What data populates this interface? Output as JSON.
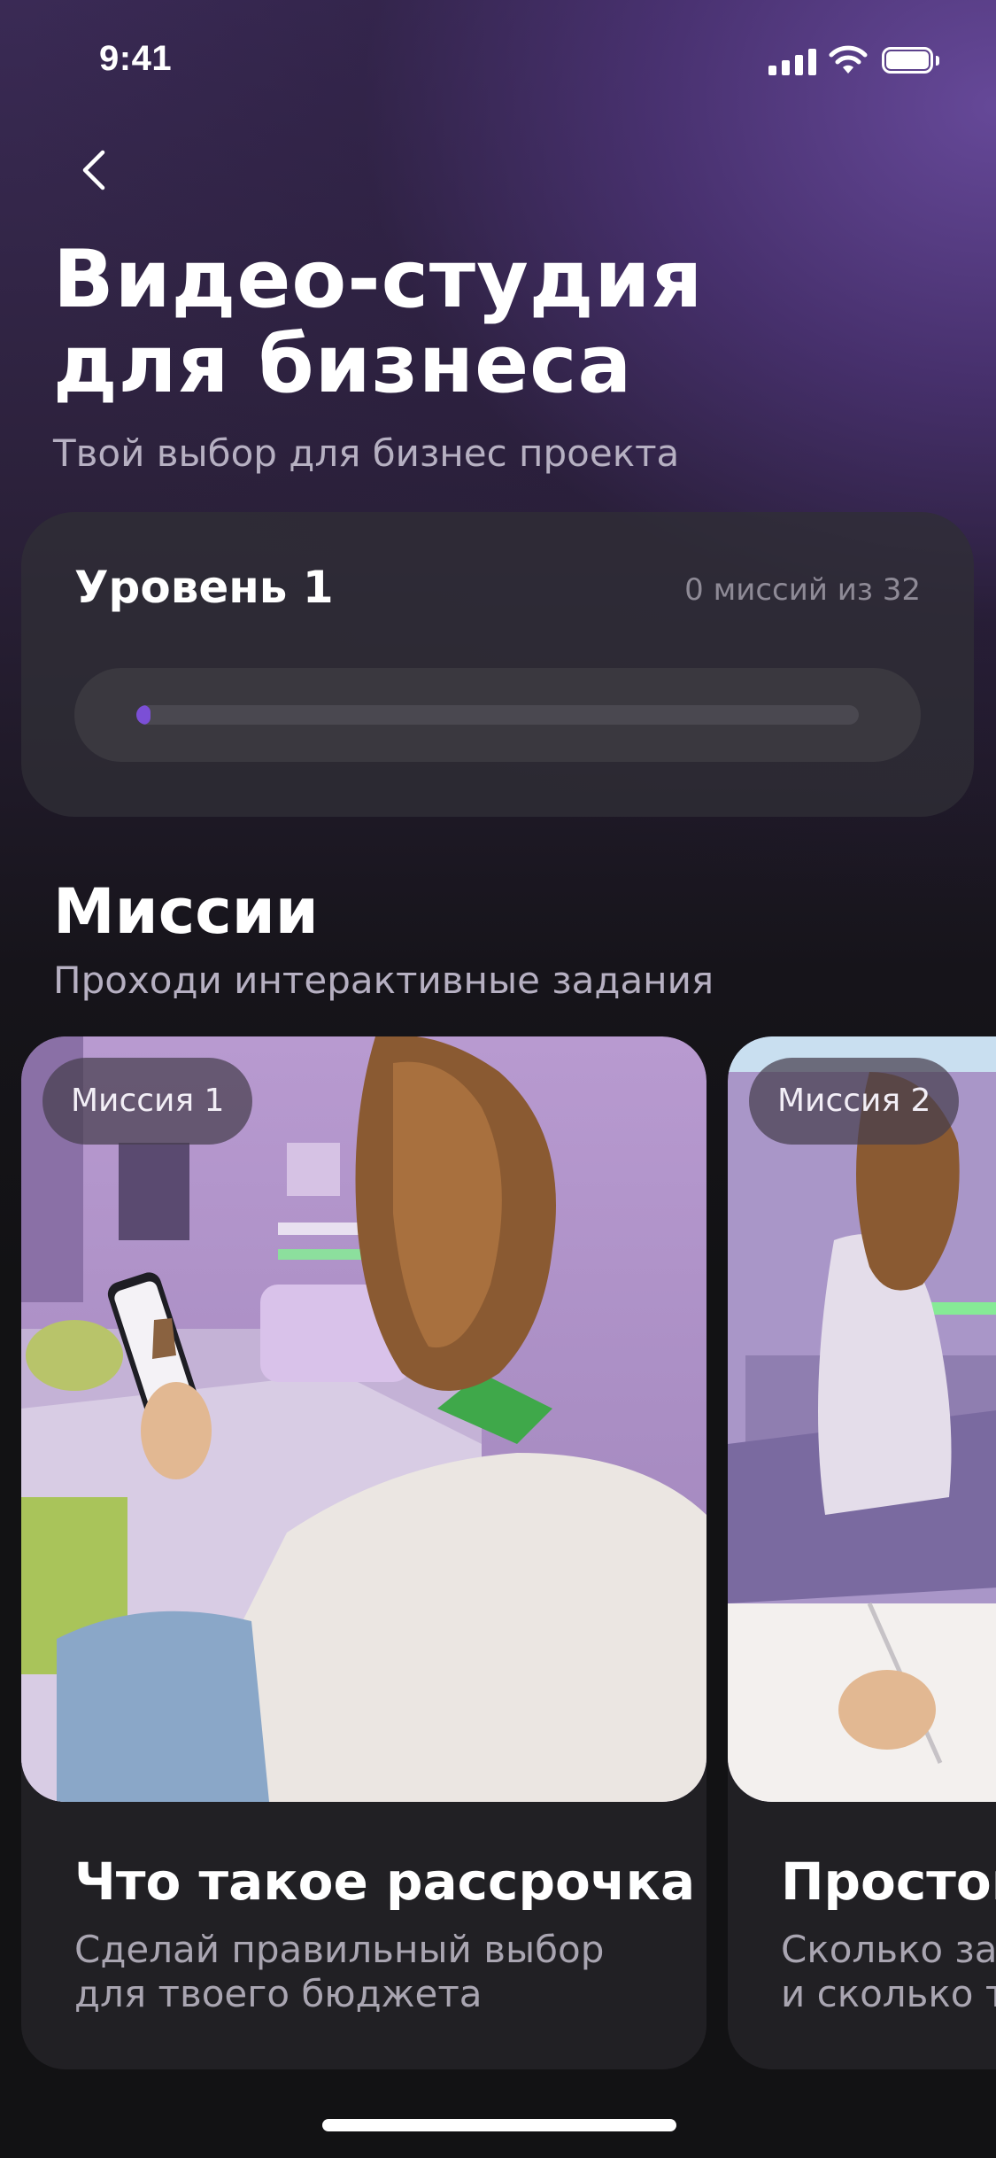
{
  "status_bar": {
    "time": "9:41"
  },
  "header": {
    "title_line1": "Видео-студия",
    "title_line2": "для бизнеса",
    "subtitle": "Твой выбор для бизнес проекта"
  },
  "level": {
    "title": "Уровень 1",
    "count": "0 миссий из 32",
    "progress": 0,
    "accent_color": "#7b4fd6"
  },
  "missions": {
    "heading": "Миссии",
    "subheading": "Проходи интерактивные задания",
    "cards": [
      {
        "badge": "Миссия 1",
        "title": "Что такое рассрочка",
        "description": "Сделай правильный выбор\nдля твоего бюджета"
      },
      {
        "badge": "Миссия 2",
        "title": "Простой",
        "description": "Сколько за\nи сколько т"
      }
    ]
  },
  "icons": {
    "back": "chevron-left-icon",
    "signal": "cellular-signal-icon",
    "wifi": "wifi-icon",
    "battery": "battery-icon"
  }
}
